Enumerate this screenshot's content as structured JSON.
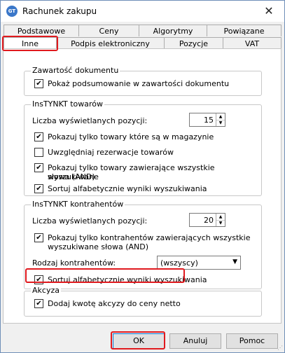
{
  "window": {
    "title": "Rachunek zakupu",
    "close_glyph": "✕",
    "icon_label": "GT"
  },
  "tabs": {
    "row1": [
      "Podstawowe",
      "Ceny",
      "Algorytmy",
      "Powiązane"
    ],
    "row2": [
      "Inne",
      "Podpis elektroniczny",
      "Pozycje",
      "VAT"
    ],
    "selected": "Inne"
  },
  "groups": {
    "zawartosc": {
      "title": "Zawartość dokumentu",
      "items": [
        {
          "label": "Pokaż podsumowanie w zawartości dokumentu",
          "checked": true
        }
      ]
    },
    "towary": {
      "title": "InsTYNKT towarów",
      "count_label": "Liczba wyświetlanych pozycji:",
      "count_value": "15",
      "items": [
        {
          "label": "Pokazuj tylko towary które są w magazynie",
          "checked": true
        },
        {
          "label": "Uwzględniaj rezerwacje towarów",
          "checked": false
        },
        {
          "label": "Pokazuj tylko towary zawierające wszystkie wyszukiwane",
          "label2": "słowa (AND)",
          "checked": true
        },
        {
          "label": "Sortuj alfabetycznie wyniki wyszukiwania",
          "checked": true
        }
      ]
    },
    "kontrahenci": {
      "title": "InsTYNKT kontrahentów",
      "count_label": "Liczba wyświetlanych pozycji:",
      "count_value": "20",
      "items": [
        {
          "label": "Pokazuj tylko kontrahentów zawierających wszystkie",
          "label2": "wyszukiwane słowa (AND)",
          "checked": true
        },
        {
          "label": "Sortuj alfabetycznie wyniki wyszukiwania",
          "checked": true
        }
      ],
      "type_label": "Rodzaj kontrahentów:",
      "type_value": "(wszyscy)"
    },
    "akcyza": {
      "title": "Akcyza",
      "items": [
        {
          "label": "Dodaj kwotę akcyzy do ceny netto",
          "checked": true
        }
      ]
    }
  },
  "buttons": {
    "ok": "OK",
    "cancel": "Anuluj",
    "help": "Pomoc"
  },
  "check_glyph": "✔",
  "annotation_color": "#e0191e"
}
